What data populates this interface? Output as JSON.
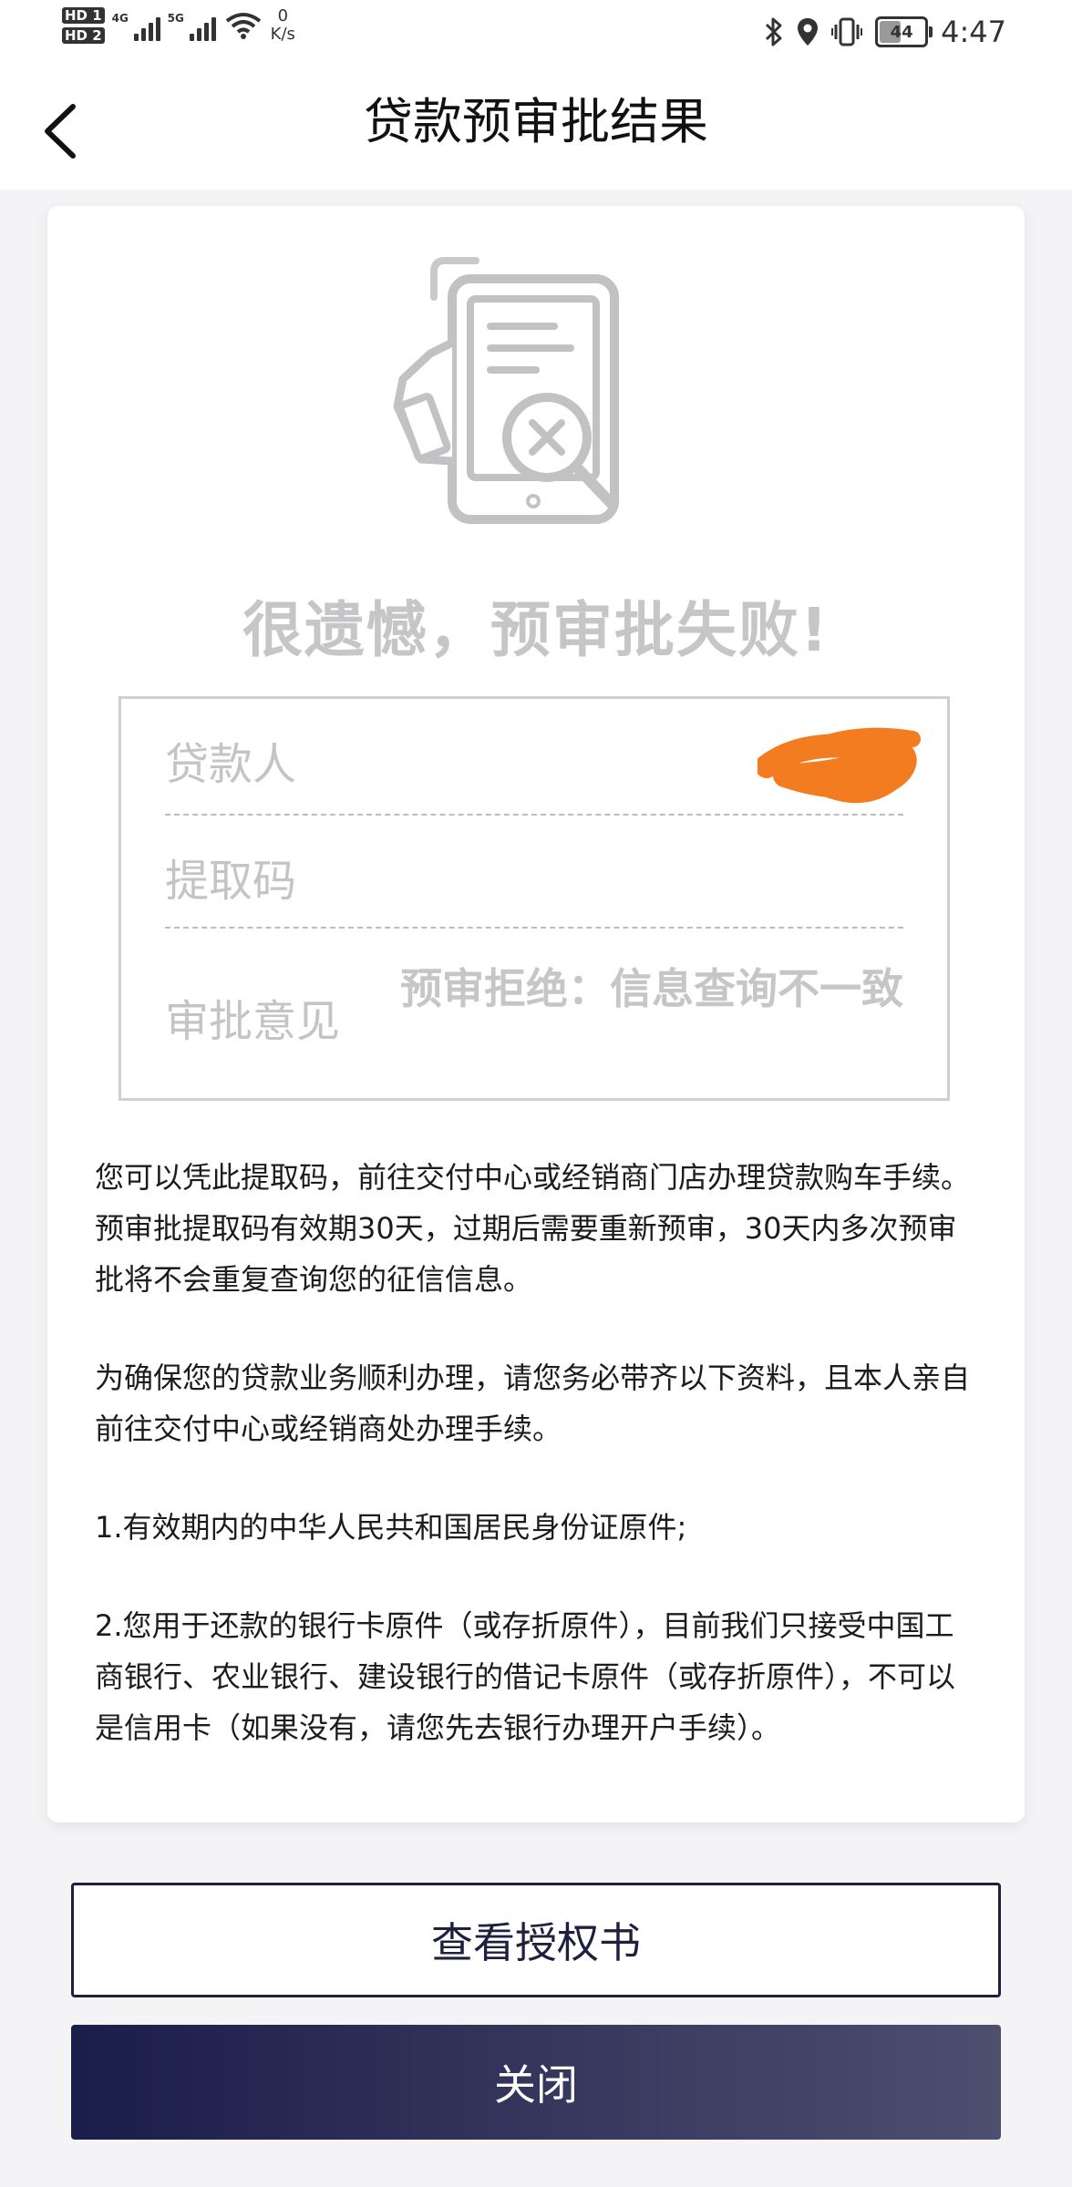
{
  "status_bar": {
    "hd1": "HD 1",
    "hd2": "HD 2",
    "net1": "4G",
    "net2": "5G",
    "speed_value": "0",
    "speed_unit": "K/s",
    "battery": "44",
    "time": "4:47"
  },
  "header": {
    "title": "贷款预审批结果"
  },
  "result": {
    "title": "很遗憾，预审批失败!",
    "rows": [
      {
        "label": "贷款人",
        "value": ""
      },
      {
        "label": "提取码",
        "value": ""
      },
      {
        "label": "审批意见",
        "value": "预审拒绝：信息查询不一致"
      }
    ]
  },
  "description": {
    "para1": "您可以凭此提取码，前往交付中心或经销商门店办理贷款购车手续。预审批提取码有效期30天，过期后需要重新预审，30天内多次预审批将不会重复查询您的征信信息。",
    "para2": "为确保您的贷款业务顺利办理，请您务必带齐以下资料，且本人亲自前往交付中心或经销商处办理手续。",
    "para3": "1.有效期内的中华人民共和国居民身份证原件;",
    "para4": "2.您用于还款的银行卡原件（或存折原件），目前我们只接受中国工商银行、农业银行、建设银行的借记卡原件（或存折原件），不可以是信用卡（如果没有，请您先去银行办理开户手续）。"
  },
  "buttons": {
    "view_auth": "查看授权书",
    "close": "关闭"
  },
  "colors": {
    "accent": "#1f2040",
    "redaction": "#f47c20",
    "muted": "#c6c6c8"
  },
  "icons": {
    "back": "chevron-left-icon",
    "illustration": "document-reject-icon"
  }
}
